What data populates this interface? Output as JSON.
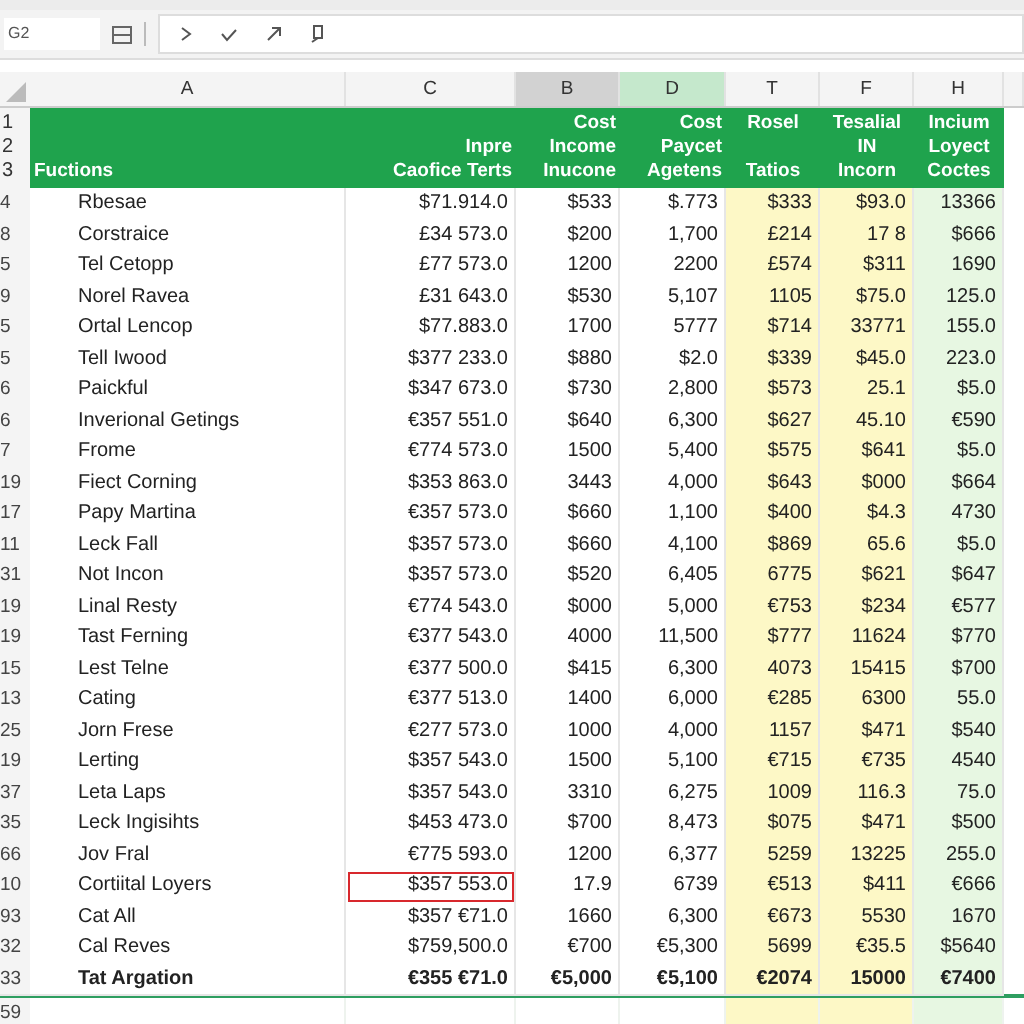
{
  "name_box": {
    "value": "G2"
  },
  "columns": [
    {
      "letter": "A",
      "kind": "label",
      "selected": false,
      "highlighted": false,
      "header": "Fuctions",
      "color": "#ffffff"
    },
    {
      "letter": "C",
      "kind": "amount",
      "selected": false,
      "highlighted": false,
      "header": "Inpre\nCaofice Terts",
      "color": "#ffffff"
    },
    {
      "letter": "B",
      "kind": "amount",
      "selected": true,
      "highlighted": false,
      "header": "Cost\nIncome\nInucone",
      "color": "#ffffff"
    },
    {
      "letter": "D",
      "kind": "amount",
      "selected": false,
      "highlighted": true,
      "header": "Cost\nPaycet\nAgetens",
      "color": "#ffffff"
    },
    {
      "letter": "T",
      "kind": "ratio",
      "selected": false,
      "highlighted": false,
      "header": "Rosel\n\nTatios",
      "color": "#fdf8c6"
    },
    {
      "letter": "F",
      "kind": "ratio",
      "selected": false,
      "highlighted": false,
      "header": "Tesalial\nIN\nIncorn",
      "color": "#fdf8c6"
    },
    {
      "letter": "H",
      "kind": "ratio",
      "selected": false,
      "highlighted": false,
      "header": "Incium\nLoyect\nCoctes",
      "color": "#e7f7e2"
    }
  ],
  "header_row_numbers": [
    "1",
    "2",
    "3"
  ],
  "rows": [
    {
      "num": "4",
      "kind": "data",
      "selected": false,
      "cells": [
        "Rbesae",
        "$71.914.0",
        "$533",
        "$.773",
        "$333",
        "$93.0",
        "13366"
      ]
    },
    {
      "num": "8",
      "kind": "data",
      "selected": false,
      "cells": [
        "Corstraice",
        "£34 573.0",
        "$200",
        "1,700",
        "£214",
        "17 8",
        "$666"
      ]
    },
    {
      "num": "5",
      "kind": "data",
      "selected": false,
      "cells": [
        "Tel Cetopp",
        "£77 573.0",
        "1200",
        "2200",
        "£574",
        "$311",
        "1690"
      ]
    },
    {
      "num": "9",
      "kind": "data",
      "selected": false,
      "cells": [
        "Norel Ravea",
        "£31 643.0",
        "$530",
        "5,107",
        "1105",
        "$75.0",
        "125.0"
      ]
    },
    {
      "num": "5",
      "kind": "data",
      "selected": false,
      "cells": [
        "Ortal Lencop",
        "$77.883.0",
        "1700",
        "5777",
        "$714",
        "33771",
        "155.0"
      ]
    },
    {
      "num": "5",
      "kind": "data",
      "selected": false,
      "cells": [
        "Tell Iwood",
        "$377 233.0",
        "$880",
        "$2.0",
        "$339",
        "$45.0",
        "223.0"
      ]
    },
    {
      "num": "6",
      "kind": "data",
      "selected": false,
      "cells": [
        "Paickful",
        "$347 673.0",
        "$730",
        "2,800",
        "$573",
        "25.1",
        "$5.0"
      ]
    },
    {
      "num": "6",
      "kind": "data",
      "selected": false,
      "cells": [
        "Inverional Getings",
        "€357 551.0",
        "$640",
        "6,300",
        "$627",
        "45.10",
        "€590"
      ]
    },
    {
      "num": "7",
      "kind": "data",
      "selected": false,
      "cells": [
        "Frome",
        "€774 573.0",
        "1500",
        "5,400",
        "$575",
        "$641",
        "$5.0"
      ]
    },
    {
      "num": "19",
      "kind": "data",
      "selected": false,
      "cells": [
        "Fiect Corning",
        "$353 863.0",
        "3443",
        "4,000",
        "$643",
        "$000",
        "$664"
      ]
    },
    {
      "num": "17",
      "kind": "data",
      "selected": false,
      "cells": [
        "Papy Martina",
        "€357 573.0",
        "$660",
        "1,100",
        "$400",
        "$4.3",
        "4730"
      ]
    },
    {
      "num": "11",
      "kind": "data",
      "selected": false,
      "cells": [
        "Leck Fall",
        "$357 573.0",
        "$660",
        "4,100",
        "$869",
        "65.6",
        "$5.0"
      ]
    },
    {
      "num": "31",
      "kind": "data",
      "selected": false,
      "cells": [
        "Not Incon",
        "$357 573.0",
        "$520",
        "6,405",
        "6775",
        "$621",
        "$647"
      ]
    },
    {
      "num": "19",
      "kind": "data",
      "selected": false,
      "cells": [
        "Linal Resty",
        "€774 543.0",
        "$000",
        "5,000",
        "€753",
        "$234",
        "€577"
      ]
    },
    {
      "num": "19",
      "kind": "data",
      "selected": false,
      "cells": [
        "Tast Ferning",
        "€377 543.0",
        "4000",
        "11,500",
        "$777",
        "11624",
        "$770"
      ]
    },
    {
      "num": "15",
      "kind": "data",
      "selected": false,
      "cells": [
        "Lest Telne",
        "€377 500.0",
        "$415",
        "6,300",
        "4073",
        "15415",
        "$700"
      ]
    },
    {
      "num": "13",
      "kind": "data",
      "selected": false,
      "cells": [
        "Cating",
        "€377 513.0",
        "1400",
        "6,000",
        "€285",
        "6300",
        "55.0"
      ]
    },
    {
      "num": "25",
      "kind": "data",
      "selected": false,
      "cells": [
        "Jorn Frese",
        "€277 573.0",
        "1000",
        "4,000",
        "1157",
        "$471",
        "$540"
      ]
    },
    {
      "num": "19",
      "kind": "data",
      "selected": false,
      "cells": [
        "Lerting",
        "$357 543.0",
        "1500",
        "5,100",
        "€715",
        "€735",
        "4540"
      ]
    },
    {
      "num": "37",
      "kind": "data",
      "selected": false,
      "cells": [
        "Leta Laps",
        "$357 543.0",
        "3310",
        "6,275",
        "1009",
        "116.3",
        "75.0"
      ]
    },
    {
      "num": "35",
      "kind": "data",
      "selected": false,
      "cells": [
        "Leck Ingisihts",
        "$453 473.0",
        "$700",
        "8,473",
        "$075",
        "$471",
        "$500"
      ]
    },
    {
      "num": "66",
      "kind": "data",
      "selected": false,
      "cells": [
        "Jov Fral",
        "€775 593.0",
        "1200",
        "6,377",
        "5259",
        "13225",
        "255.0"
      ]
    },
    {
      "num": "10",
      "kind": "data",
      "selected": true,
      "cells": [
        "Cortiital Loyers",
        "$357 553.0",
        "17.9",
        "6739",
        "€513",
        "$411",
        "€666"
      ]
    },
    {
      "num": "93",
      "kind": "data",
      "selected": false,
      "cells": [
        "Cat All",
        "$357 €71.0",
        "1660",
        "6,300",
        "€673",
        "5530",
        "1670"
      ]
    },
    {
      "num": "32",
      "kind": "data",
      "selected": false,
      "cells": [
        "Cal Reves",
        "$759,500.0",
        "€700",
        "€5,300",
        "5699",
        "€35.5",
        "$5640"
      ]
    },
    {
      "num": "33",
      "kind": "total",
      "selected": false,
      "cells": [
        "Tat Argation",
        "€355 €71.0",
        "€5,000",
        "€5,100",
        "€2074",
        "15000",
        "€7400"
      ]
    },
    {
      "num": "59",
      "kind": "blank",
      "selected": false,
      "cells": []
    }
  ]
}
